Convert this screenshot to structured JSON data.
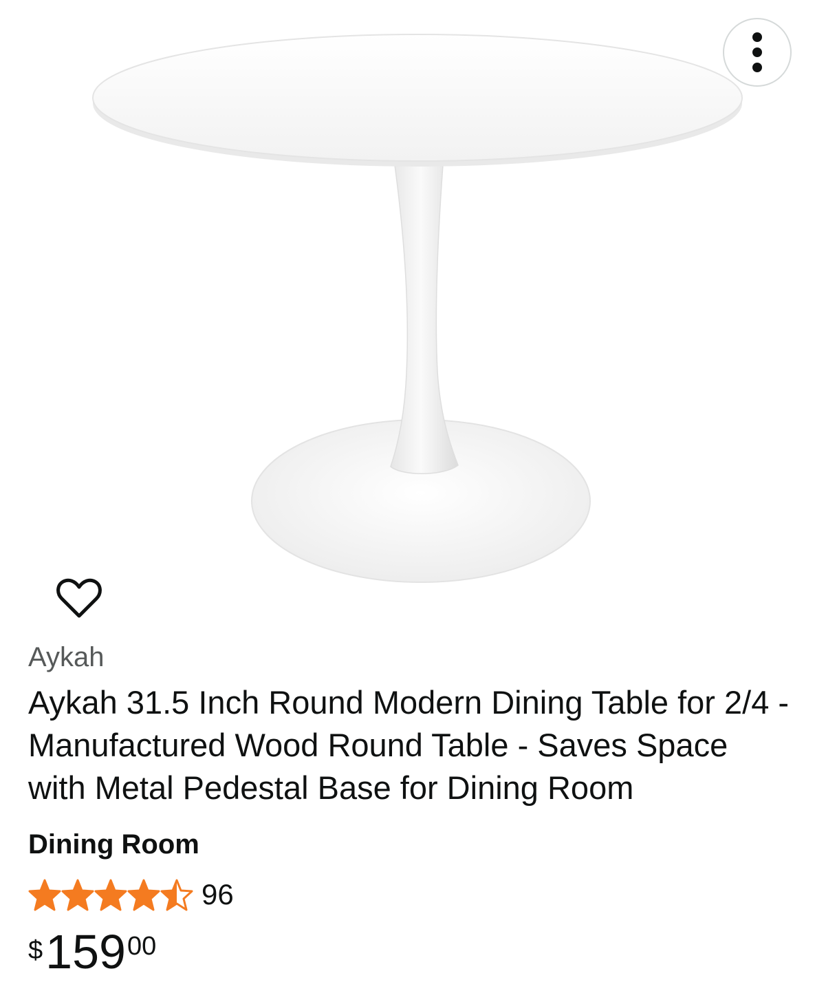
{
  "product": {
    "brand": "Aykah",
    "title": "Aykah 31.5 Inch Round Modern Dining Table for 2/4 - Manufactured Wood Round Table - Saves Space with Metal Pedestal Base for Dining Room",
    "category": "Dining Room",
    "rating": {
      "stars": 4.5,
      "max": 5,
      "count": "96"
    },
    "price": {
      "symbol": "$",
      "whole": "159",
      "fraction": "00"
    }
  },
  "icons": {
    "more": "more-vertical-icon",
    "favorite": "heart-icon",
    "star": "star-icon"
  },
  "colors": {
    "star": "#f47b20",
    "text": "#0f1111",
    "muted": "#565959"
  }
}
